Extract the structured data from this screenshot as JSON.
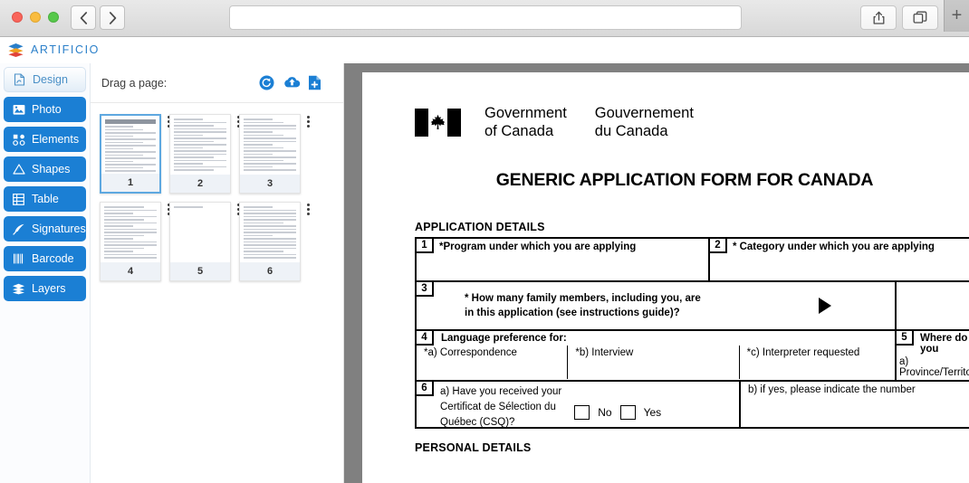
{
  "browser": {
    "traffic_lights": [
      "close",
      "minimize",
      "maximize"
    ],
    "back_label": "‹",
    "forward_label": "›",
    "address_value": "",
    "address_placeholder": "",
    "share_icon": "share-icon",
    "tabs_icon": "tabs-overview-icon",
    "newtab_label": "+"
  },
  "app": {
    "brand_name": "ARTIFICIO",
    "brand_colors": {
      "top": "#2a7fc9",
      "middle": "#f0a020",
      "bottom": "#e0443a"
    }
  },
  "sidebar": {
    "accent_color": "#1b7fd4",
    "items": [
      {
        "label": "Design",
        "icon": "design-pdf-icon",
        "active": true
      },
      {
        "label": "Photo",
        "icon": "photo-icon",
        "active": false
      },
      {
        "label": "Elements",
        "icon": "elements-icon",
        "active": false
      },
      {
        "label": "Shapes",
        "icon": "shapes-triangle-icon",
        "active": false
      },
      {
        "label": "Table",
        "icon": "table-grid-icon",
        "active": false
      },
      {
        "label": "Signatures",
        "icon": "signature-quill-icon",
        "active": false
      },
      {
        "label": "Barcode",
        "icon": "barcode-icon",
        "active": false
      },
      {
        "label": "Layers",
        "icon": "layers-stack-icon",
        "active": false
      }
    ]
  },
  "pages_panel": {
    "drag_label": "Drag a page:",
    "actions": [
      {
        "name": "rotate-refresh-icon",
        "label": "Rotate"
      },
      {
        "name": "cloud-upload-icon",
        "label": "Upload"
      },
      {
        "name": "add-page-icon",
        "label": "Add page"
      }
    ],
    "thumbnails": [
      {
        "number": "1",
        "selected": true,
        "density": "full"
      },
      {
        "number": "2",
        "selected": false,
        "density": "full"
      },
      {
        "number": "3",
        "selected": false,
        "density": "full"
      },
      {
        "number": "4",
        "selected": false,
        "density": "full"
      },
      {
        "number": "5",
        "selected": false,
        "density": "empty"
      },
      {
        "number": "6",
        "selected": false,
        "density": "text"
      }
    ]
  },
  "document": {
    "wordmark": {
      "en_line1": "Government",
      "en_line2": "of Canada",
      "fr_line1": "Gouvernement",
      "fr_line2": "du Canada"
    },
    "title": "GENERIC APPLICATION FORM FOR CANADA",
    "sections": {
      "application_details": "APPLICATION DETAILS",
      "personal_details": "PERSONAL DETAILS"
    },
    "fields": {
      "f1_num": "1",
      "f1_label": "*Program under which you are applying",
      "f2_num": "2",
      "f2_label": "* Category under which you are applying",
      "f3_num": "3",
      "f3_question_line1": "* How many family members, including you, are",
      "f3_question_line2": "in this application (see instructions guide)?",
      "f4_num": "4",
      "f4_label": "Language preference for:",
      "f4_a": "*a) Correspondence",
      "f4_b": "*b) Interview",
      "f4_c": "*c) Interpreter requested",
      "f5_num": "5",
      "f5_label": "Where do you",
      "f5_a": "a) Province/Territor",
      "f6_num": "6",
      "f6_a_line1": "a) Have you received your",
      "f6_a_line2": "Certificat de Sélection du",
      "f6_a_line3": "Québec (CSQ)?",
      "f6_no": "No",
      "f6_yes": "Yes",
      "f6_b": "b) if yes, please indicate the number"
    }
  }
}
